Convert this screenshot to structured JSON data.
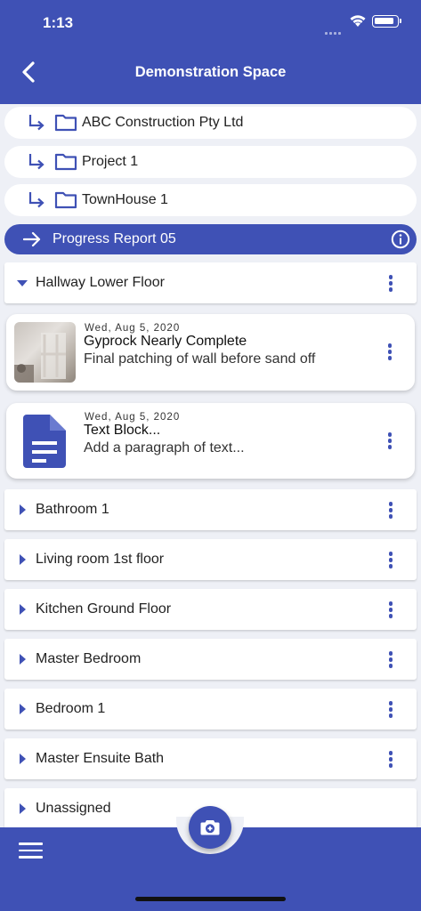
{
  "status_bar": {
    "time": "1:13"
  },
  "header": {
    "title": "Demonstration Space"
  },
  "breadcrumbs": [
    {
      "label": "ABC Construction Pty Ltd"
    },
    {
      "label": "Project 1"
    },
    {
      "label": "TownHouse 1"
    }
  ],
  "current_report": {
    "label": "Progress Report 05"
  },
  "expanded_section": {
    "label": "Hallway Lower Floor",
    "expanded": true
  },
  "entries": [
    {
      "date": "Wed, Aug 5, 2020",
      "title": "Gyprock Nearly Complete",
      "description": "Final patching of wall before sand off",
      "icon": "photo-thumbnail"
    },
    {
      "date": "Wed, Aug 5, 2020",
      "title": "Text Block...",
      "description": "Add a paragraph of text...",
      "icon": "document-icon"
    }
  ],
  "sections": [
    {
      "label": "Bathroom 1"
    },
    {
      "label": "Living room 1st floor"
    },
    {
      "label": "Kitchen Ground Floor"
    },
    {
      "label": "Master Bedroom"
    },
    {
      "label": "Bedroom 1"
    },
    {
      "label": "Master Ensuite Bath"
    },
    {
      "label": "Unassigned"
    }
  ],
  "colors": {
    "primary": "#3f51b5",
    "background": "#eef0f6",
    "card": "#ffffff"
  },
  "icons": {
    "back": "chevron-left-icon",
    "breadcrumb": "subdirectory-arrow-icon",
    "folder": "folder-icon",
    "current": "arrow-right-icon",
    "info": "info-icon",
    "more": "more-vertical-icon",
    "camera": "camera-plus-icon",
    "menu": "hamburger-menu-icon"
  }
}
